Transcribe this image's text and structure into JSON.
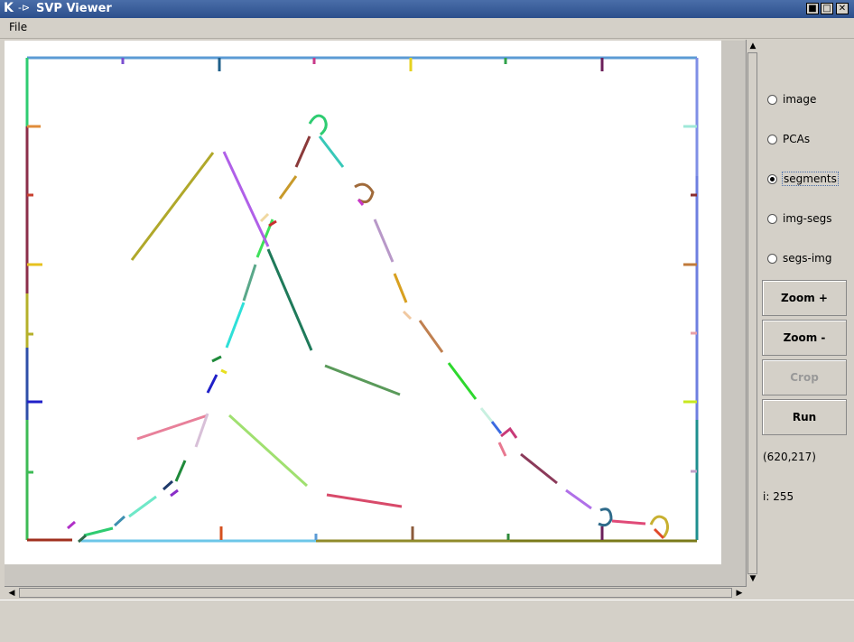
{
  "window": {
    "title": "SVP Viewer",
    "logo": "K",
    "pin_glyph": "-⊳",
    "minimize_glyph": "■",
    "maximize_glyph": "□",
    "close_glyph": "✕"
  },
  "menu": {
    "file": "File"
  },
  "options": [
    {
      "label": "image",
      "selected": false
    },
    {
      "label": "PCAs",
      "selected": false
    },
    {
      "label": "segments",
      "selected": true
    },
    {
      "label": "img-segs",
      "selected": false
    },
    {
      "label": "segs-img",
      "selected": false
    }
  ],
  "buttons": {
    "zoom_in": "Zoom +",
    "zoom_out": "Zoom -",
    "crop": "Crop",
    "run": "Run"
  },
  "status": {
    "coords": "(620,217)",
    "intensity": "i: 255"
  },
  "scroll": {
    "up": "▲",
    "down": "▼",
    "left": "◀",
    "right": "▶"
  },
  "colors": {
    "title_bar": "#3a5f9e",
    "canvas": "#ffffff",
    "window_bg": "#d4d0c8"
  }
}
